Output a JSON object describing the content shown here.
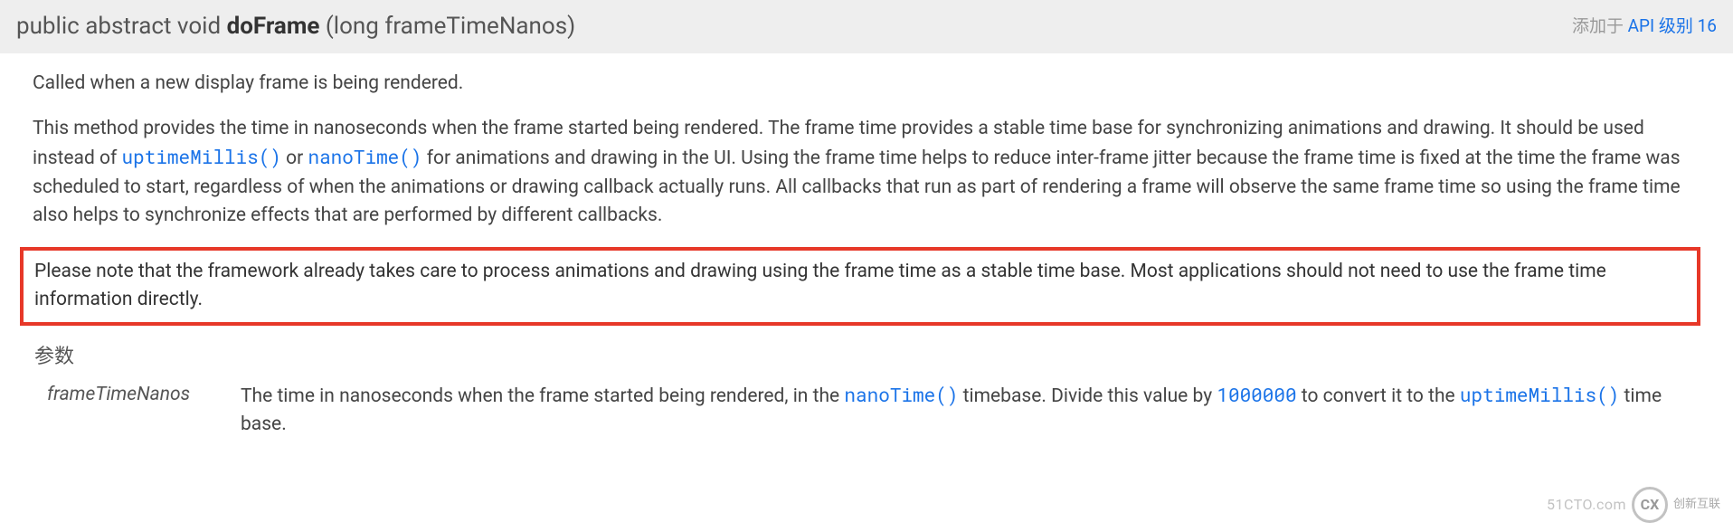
{
  "signature": {
    "prefix": "public abstract void ",
    "method": "doFrame",
    "params": " (long frameTimeNanos)"
  },
  "api_added": {
    "prefix": "添加于 ",
    "link": "API 级别 16"
  },
  "paragraphs": {
    "p1": "Called when a new display frame is being rendered.",
    "p2a": "This method provides the time in nanoseconds when the frame started being rendered. The frame time provides a stable time base for synchronizing animations and drawing. It should be used instead of ",
    "p2_code1": "uptimeMillis()",
    "p2b": " or ",
    "p2_code2": "nanoTime()",
    "p2c": " for animations and drawing in the UI. Using the frame time helps to reduce inter-frame jitter because the frame time is fixed at the time the frame was scheduled to start, regardless of when the animations or drawing callback actually runs. All callbacks that run as part of rendering a frame will observe the same frame time so using the frame time also helps to synchronize effects that are performed by different callbacks.",
    "p3": "Please note that the framework already takes care to process animations and drawing using the frame time as a stable time base. Most applications should not need to use the frame time information directly."
  },
  "params_section": {
    "heading": "参数",
    "name": "frameTimeNanos",
    "desc_a": "The time in nanoseconds when the frame started being rendered, in the ",
    "desc_code1": "nanoTime()",
    "desc_b": " timebase. Divide this value by ",
    "desc_code2": "1000000",
    "desc_c": " to convert it to the ",
    "desc_code3": "uptimeMillis()",
    "desc_d": " time base."
  },
  "watermark": {
    "url": "51CTO.com",
    "logo": "CX",
    "cn": "创新互联"
  }
}
